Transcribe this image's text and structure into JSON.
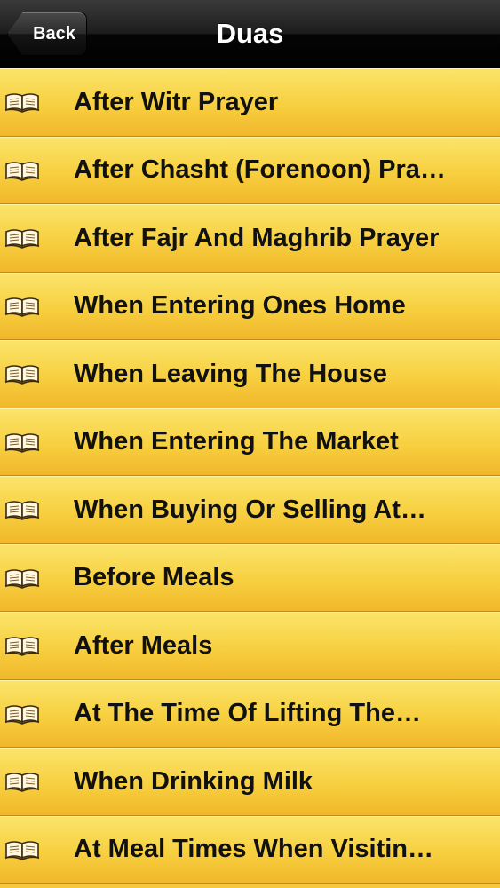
{
  "navbar": {
    "back_label": "Back",
    "title": "Duas"
  },
  "colors": {
    "row_top": "#fbe46a",
    "row_bottom": "#f1b72b",
    "navbar": "#000000"
  },
  "list": {
    "icon": "book-icon",
    "items": [
      {
        "label": "After Witr Prayer"
      },
      {
        "label": "After Chasht (Forenoon) Pra…"
      },
      {
        "label": "After Fajr And Maghrib Prayer"
      },
      {
        "label": "When Entering Ones Home"
      },
      {
        "label": "When Leaving The House"
      },
      {
        "label": "When Entering The Market"
      },
      {
        "label": "When Buying Or Selling At…"
      },
      {
        "label": "Before Meals"
      },
      {
        "label": "After Meals"
      },
      {
        "label": "At The Time Of Lifting The…"
      },
      {
        "label": "When Drinking Milk"
      },
      {
        "label": "At Meal Times When Visitin…"
      }
    ]
  }
}
